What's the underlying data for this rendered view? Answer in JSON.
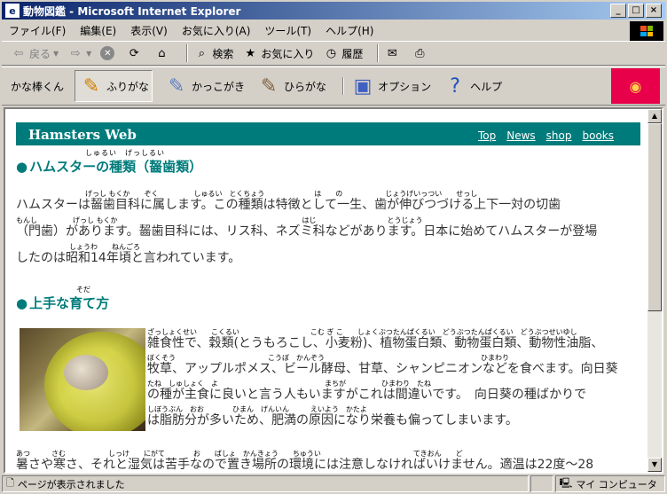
{
  "window": {
    "title": "動物図鑑 - Microsoft Internet Explorer",
    "app_icon": "ie-icon",
    "controls": [
      "_",
      "□",
      "×"
    ]
  },
  "menu": [
    "ファイル(F)",
    "編集(E)",
    "表示(V)",
    "お気に入り(A)",
    "ツール(T)",
    "ヘルプ(H)"
  ],
  "toolbar": {
    "back": "戻る",
    "search": "検索",
    "favorites": "お気に入り",
    "history": "履歴"
  },
  "ruby_toolbar": {
    "label": "かな棒くん",
    "items": [
      "ふりがな",
      "かっこがき",
      "ひらがな",
      "オプション",
      "ヘルプ"
    ]
  },
  "page": {
    "banner_title": "Hamsters Web",
    "nav_links": [
      "Top",
      "News",
      "shop",
      "books"
    ],
    "section1": {
      "heading": "ハムスターの種類（齧歯類）",
      "ruby": "しゅるい　げっしるい",
      "line1": "ハムスターは齧歯目科に属します。この種類は特徴として一生、歯が伸びつづける上下一対の切歯",
      "line2": "（門歯）があります。齧歯目科には、リス科、ネズミ科などがあります。日本に始めてハムスターが登場",
      "line3": "したのは昭和14年頃と言われています。",
      "ruby1": "げっし もくか　　ぞく　　　　　しゅるい　とくちょう　　　　　　　は　　の　　　　　　じょうげいっつい　　せっし",
      "ruby2": "もんし　　　　　げっし もくか　　　　　　　　　　　　　　　　　　　　　　　　　　はじ　　　　　　　　　　とうじょう",
      "ruby3": "しょうわ　　ねんごろ"
    },
    "section2": {
      "heading": "上手な育て方",
      "ruby": "そだ",
      "line1": "雑食性で、穀類(とうもろこし、小麦粉)、植物蛋白類、動物蛋白類、動物性油脂、",
      "line2": "牧草、アップルポメス、ビール酵母、甘草、シャンピニオンなどを食べます。向日葵",
      "line3": "の種が主食に良いと言う人もいますがこれは間違いです。　向日葵の種ばかりで",
      "line4": "は脂肪分が多いため、肥満の原因になり栄養も偏ってしまいます。",
      "line5": "暑さや寒さ、それと湿気は苦手なので置き場所の環境には注意しなければいけません。適温は22度〜28",
      "ruby1": "ざっしょくせい　　こくるい　　　　　　　　　　こむ ぎ こ　　しょくぶつたんぱくるい　どうぶつたんぱくるい　どうぶつせいゆし",
      "ruby2": "ぼくそう　　　　　　　　　　　　　こうぼ　かんぞう　　　　　　　　　　　　　　　　　　　　　　ひまわり",
      "ruby3": "たね　しゅしょく　よ　　　　　　　　　　　　　　　まちが　　　　　ひまわり　たね",
      "ruby4": "しぼうぶん　おお　　　　ひまん　げんいん　　　えいよう　かたよ",
      "ruby5": "あつ　　　さむ　　　　　　しっけ　　にがて　　　　お　　ばしょ　かんきょう　　ちゅうい　　　　　　　　　　　　　てきおん　　ど"
    }
  },
  "status": {
    "left": "ページが表示されました",
    "zone": "マイ コンピュータ"
  },
  "colors": {
    "teal": "#007b7b",
    "titlebar_start": "#0a246a",
    "titlebar_end": "#a6caf0",
    "pink": "#e8004a"
  }
}
